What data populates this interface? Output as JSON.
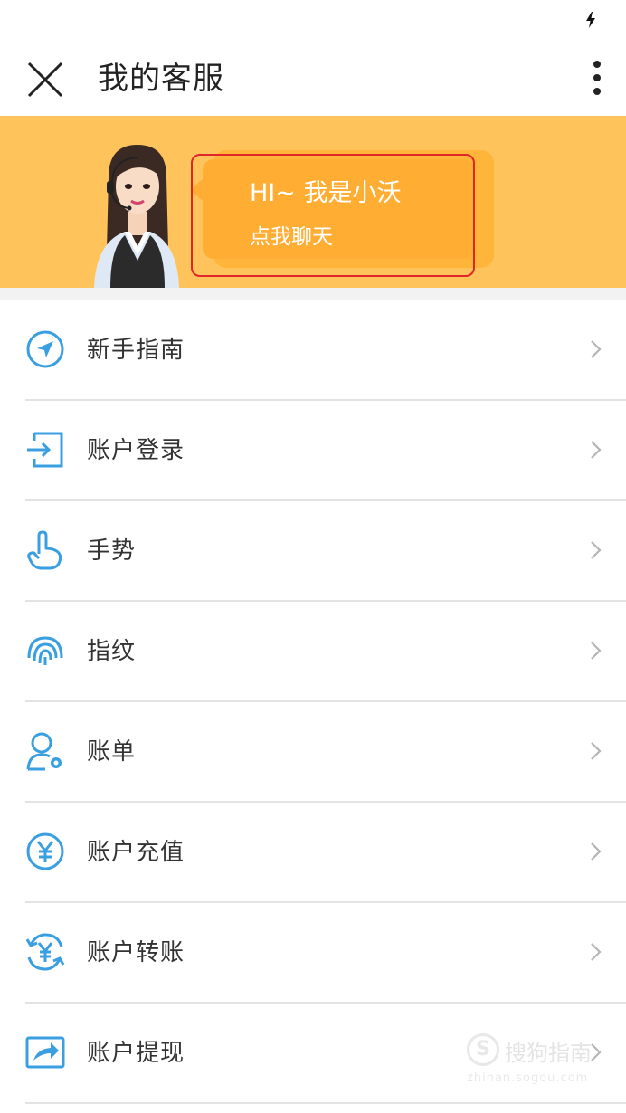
{
  "status_bar": {
    "icon": "charging-bolt-icon"
  },
  "header": {
    "title": "我的客服",
    "close_icon": "close-icon",
    "more_icon": "more-vertical-icon"
  },
  "banner": {
    "bubble_title": "HI~ 我是小沃",
    "bubble_subtitle": "点我聊天",
    "background_color": "#ffc35c",
    "bubble_color": "#ffad33",
    "highlight_color": "#e0262a"
  },
  "menu": {
    "items": [
      {
        "label": "新手指南",
        "icon": "compass-icon"
      },
      {
        "label": "账户登录",
        "icon": "login-icon"
      },
      {
        "label": "手势",
        "icon": "hand-gesture-icon"
      },
      {
        "label": "指纹",
        "icon": "fingerprint-icon"
      },
      {
        "label": "账单",
        "icon": "user-settings-icon"
      },
      {
        "label": "账户充值",
        "icon": "yuan-recharge-icon"
      },
      {
        "label": "账户转账",
        "icon": "yuan-transfer-icon"
      },
      {
        "label": "账户提现",
        "icon": "withdraw-icon"
      }
    ],
    "icon_color": "#3a9fe0"
  },
  "watermark": {
    "logo_letter": "S",
    "text": "搜狗指南",
    "url": "zhinan.sogou.com"
  }
}
